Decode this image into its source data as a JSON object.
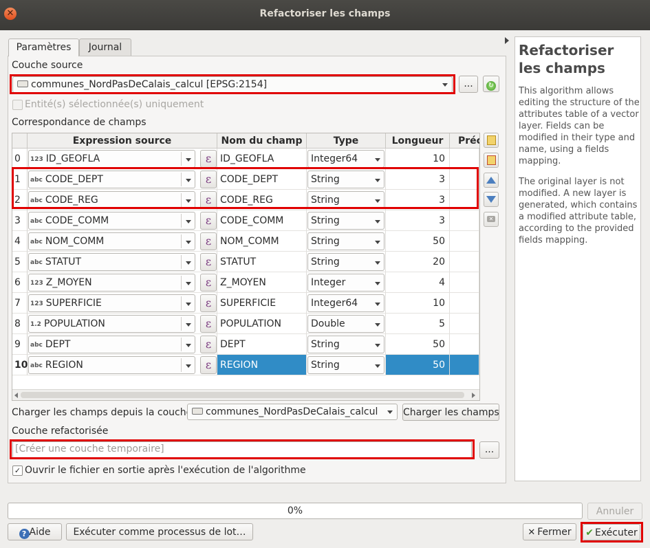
{
  "window": {
    "title": "Refactoriser les champs"
  },
  "tabs": [
    {
      "label": "Paramètres"
    },
    {
      "label": "Journal"
    }
  ],
  "source": {
    "label": "Couche source",
    "value": "communes_NordPasDeCalais_calcul [EPSG:2154]",
    "browse_label": "...",
    "selected_only_label": "Entité(s) sélectionnée(s) uniquement"
  },
  "mapping": {
    "label": "Correspondance de champs",
    "headers": [
      "Expression source",
      "Nom du champ",
      "Type",
      "Longueur",
      "Préc"
    ],
    "rows": [
      {
        "idx": "0",
        "icon": "123",
        "expr": "ID_GEOFLA",
        "name": "ID_GEOFLA",
        "type": "Integer64",
        "len": "10"
      },
      {
        "idx": "1",
        "icon": "abc",
        "expr": "CODE_DEPT",
        "name": "CODE_DEPT",
        "type": "String",
        "len": "3"
      },
      {
        "idx": "2",
        "icon": "abc",
        "expr": "CODE_REG",
        "name": "CODE_REG",
        "type": "String",
        "len": "3"
      },
      {
        "idx": "3",
        "icon": "abc",
        "expr": "CODE_COMM",
        "name": "CODE_COMM",
        "type": "String",
        "len": "3"
      },
      {
        "idx": "4",
        "icon": "abc",
        "expr": "NOM_COMM",
        "name": "NOM_COMM",
        "type": "String",
        "len": "50"
      },
      {
        "idx": "5",
        "icon": "abc",
        "expr": "STATUT",
        "name": "STATUT",
        "type": "String",
        "len": "20"
      },
      {
        "idx": "6",
        "icon": "123",
        "expr": "Z_MOYEN",
        "name": "Z_MOYEN",
        "type": "Integer",
        "len": "4"
      },
      {
        "idx": "7",
        "icon": "123",
        "expr": "SUPERFICIE",
        "name": "SUPERFICIE",
        "type": "Integer64",
        "len": "10"
      },
      {
        "idx": "8",
        "icon": "1.2",
        "expr": "POPULATION",
        "name": "POPULATION",
        "type": "Double",
        "len": "5"
      },
      {
        "idx": "9",
        "icon": "abc",
        "expr": "DEPT",
        "name": "DEPT",
        "type": "String",
        "len": "50"
      },
      {
        "idx": "10",
        "icon": "abc",
        "expr": "REGION",
        "name": "REGION",
        "type": "String",
        "len": "50"
      }
    ],
    "epsilon": "ε"
  },
  "load_fields": {
    "label": "Charger les champs depuis la couche",
    "value": "communes_NordPasDeCalais_calcul",
    "button": "Charger les champs"
  },
  "output": {
    "label": "Couche refactorisée",
    "placeholder": "[Créer une couche temporaire]",
    "browse_label": "...",
    "open_label": "Ouvrir le fichier en sortie après l'exécution de l'algorithme"
  },
  "help": {
    "title": "Refactoriser les champs",
    "p1": "This algorithm allows editing the structure of the attributes table of a vector layer. Fields can be modified in their type and name, using a fields mapping.",
    "p2": "The original layer is not modified. A new layer is generated, which contains a modified attribute table, according to the provided fields mapping."
  },
  "progress": {
    "text": "0%",
    "value": 0
  },
  "buttons": {
    "cancel": "Annuler",
    "help": "Aide",
    "batch": "Exécuter comme processus de lot…",
    "close": "Fermer",
    "run": "Exécuter"
  },
  "colors": {
    "highlight": "#e00000",
    "selection": "#308cc6"
  }
}
